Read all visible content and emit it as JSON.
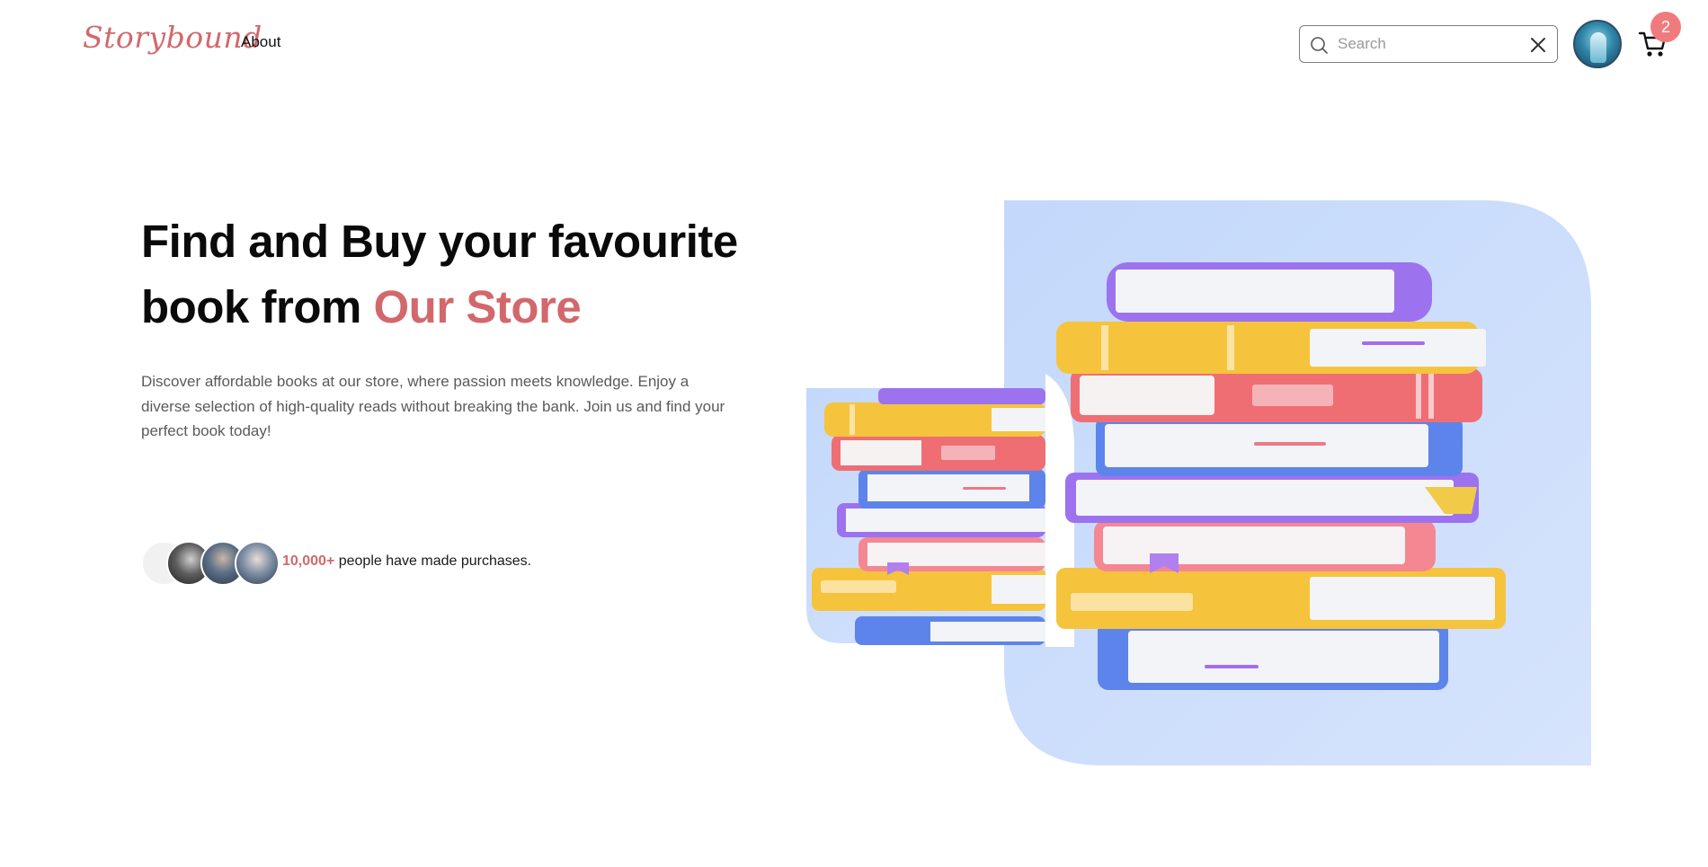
{
  "nav": {
    "brand": "Storybound",
    "links": [
      {
        "label": "About"
      }
    ]
  },
  "search": {
    "placeholder": "Search",
    "value": ""
  },
  "cart": {
    "count": "2"
  },
  "icons": {
    "search": "search-icon",
    "clear": "close-icon",
    "cart": "cart-icon"
  },
  "hero": {
    "title_part1": "Find and Buy your favourite",
    "title_part2": "book from",
    "title_accent": "Our Store",
    "description": "Discover affordable books at our store, where passion meets knowledge. Enjoy a diverse selection of high-quality reads without breaking the bank. Join us and find your perfect book today!",
    "proof_count": "10,000+",
    "proof_text": "people have made purchases."
  },
  "colors": {
    "accent": "#d2686c",
    "badge": "#f07b7e",
    "hero_bg": "#c9dcfb"
  }
}
